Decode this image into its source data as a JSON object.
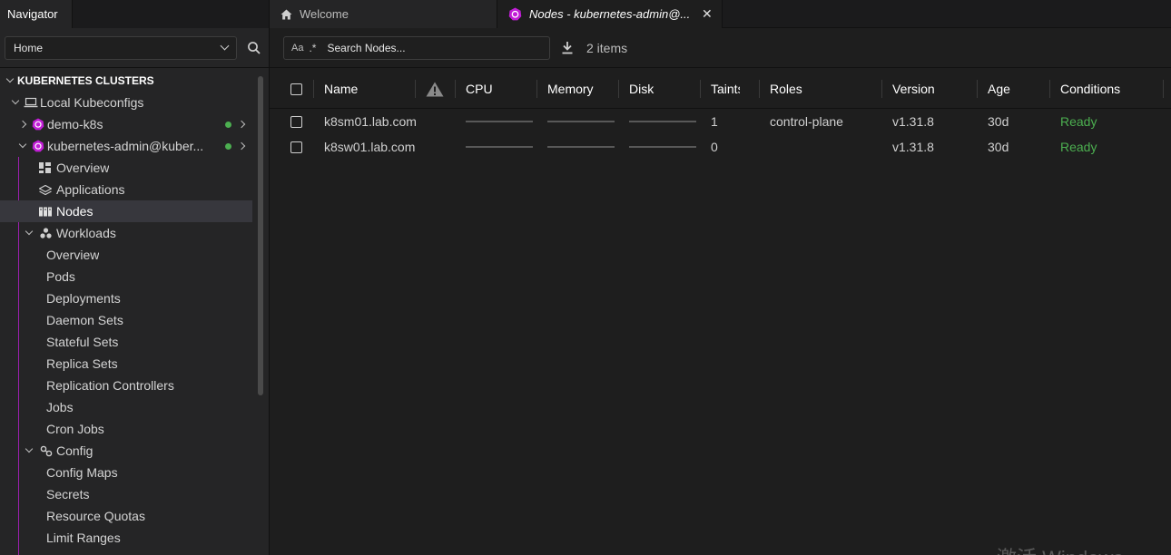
{
  "navigator": {
    "title": "Navigator",
    "hotbar_select": "Home",
    "tree": {
      "section_header": "KUBERNETES CLUSTERS",
      "local_kubeconfigs": "Local Kubeconfigs",
      "clusters": [
        {
          "name": "demo-k8s",
          "status_color": "#4caf50"
        },
        {
          "name": "kubernetes-admin@kuber...",
          "status_color": "#4caf50"
        }
      ],
      "cluster_items": {
        "overview": "Overview",
        "applications": "Applications",
        "nodes": "Nodes"
      },
      "workloads": {
        "label": "Workloads",
        "items": [
          "Overview",
          "Pods",
          "Deployments",
          "Daemon Sets",
          "Stateful Sets",
          "Replica Sets",
          "Replication Controllers",
          "Jobs",
          "Cron Jobs"
        ]
      },
      "config": {
        "label": "Config",
        "items": [
          "Config Maps",
          "Secrets",
          "Resource Quotas",
          "Limit Ranges"
        ]
      }
    }
  },
  "tabs": [
    {
      "label": "Welcome",
      "icon": "home-icon"
    },
    {
      "label": "Nodes - kubernetes-admin@...",
      "icon": "kubernetes-icon",
      "active": true
    }
  ],
  "toolbar": {
    "search_placeholder": "Search Nodes...",
    "case_toggle": "Aa",
    "regex_toggle": ".*",
    "items_count": "2 items"
  },
  "table": {
    "columns": [
      "Name",
      "warning-icon",
      "CPU",
      "Memory",
      "Disk",
      "Taints",
      "Roles",
      "Version",
      "Age",
      "Conditions"
    ],
    "column_labels": {
      "name": "Name",
      "cpu": "CPU",
      "memory": "Memory",
      "disk": "Disk",
      "taints": "Taints",
      "roles": "Roles",
      "version": "Version",
      "age": "Age",
      "conditions": "Conditions"
    },
    "rows": [
      {
        "name": "k8sm01.lab.com",
        "taints": "1",
        "roles": "control-plane",
        "version": "v1.31.8",
        "age": "30d",
        "conditions": "Ready"
      },
      {
        "name": "k8sw01.lab.com",
        "taints": "0",
        "roles": "",
        "version": "v1.31.8",
        "age": "30d",
        "conditions": "Ready"
      }
    ]
  },
  "colors": {
    "accent_purple": "#9b1fae",
    "kubernetes_icon": "#c11ed6",
    "status_ready": "#4caf50"
  },
  "watermark": "激活 Windows"
}
